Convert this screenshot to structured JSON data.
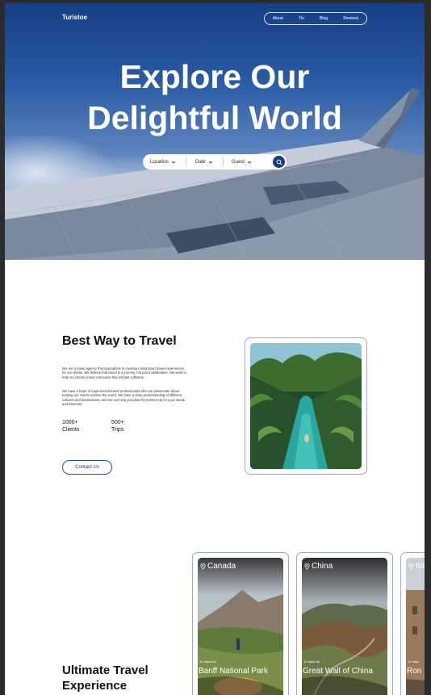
{
  "brand": "Turistoe",
  "nav": [
    "About",
    "Tis",
    "Blog",
    "Reviews"
  ],
  "hero": {
    "title_line1": "Explore Our",
    "title_line2": "Delightful World"
  },
  "search": {
    "location": "Location",
    "date": "Date",
    "guest": "Guest"
  },
  "about": {
    "title": "Best Way to Travel",
    "p1": "We are a travel agency that specializes in creating customized travel experiences for our clients. We believe that travel is a journey, not just a destination. We want to help our clients create memories that will last a lifetime.",
    "p2": "We have a team of experienced travel professionals who are passionate about helping our clients explore the world. We have a deep understanding of different cultures and destinations, and we can help you plan the perfect trip for your needs and interests.",
    "stats": [
      {
        "value": "1000+",
        "label": "Clients"
      },
      {
        "value": "500+",
        "label": "Trips"
      }
    ],
    "contact_label": "Contact Us"
  },
  "destinations": {
    "title": "Ultimate Travel Experience",
    "cards": [
      {
        "country": "Canada",
        "trip": "10 days trip",
        "name": "Banff National Park"
      },
      {
        "country": "China",
        "trip": "11 days trip",
        "name": "Great Wall of China"
      },
      {
        "country": "Ita",
        "trip": "10 days",
        "name": "Ron"
      }
    ]
  },
  "colors": {
    "primary": "#143d80",
    "card_border": "#9aaac8",
    "text": "#111111"
  }
}
